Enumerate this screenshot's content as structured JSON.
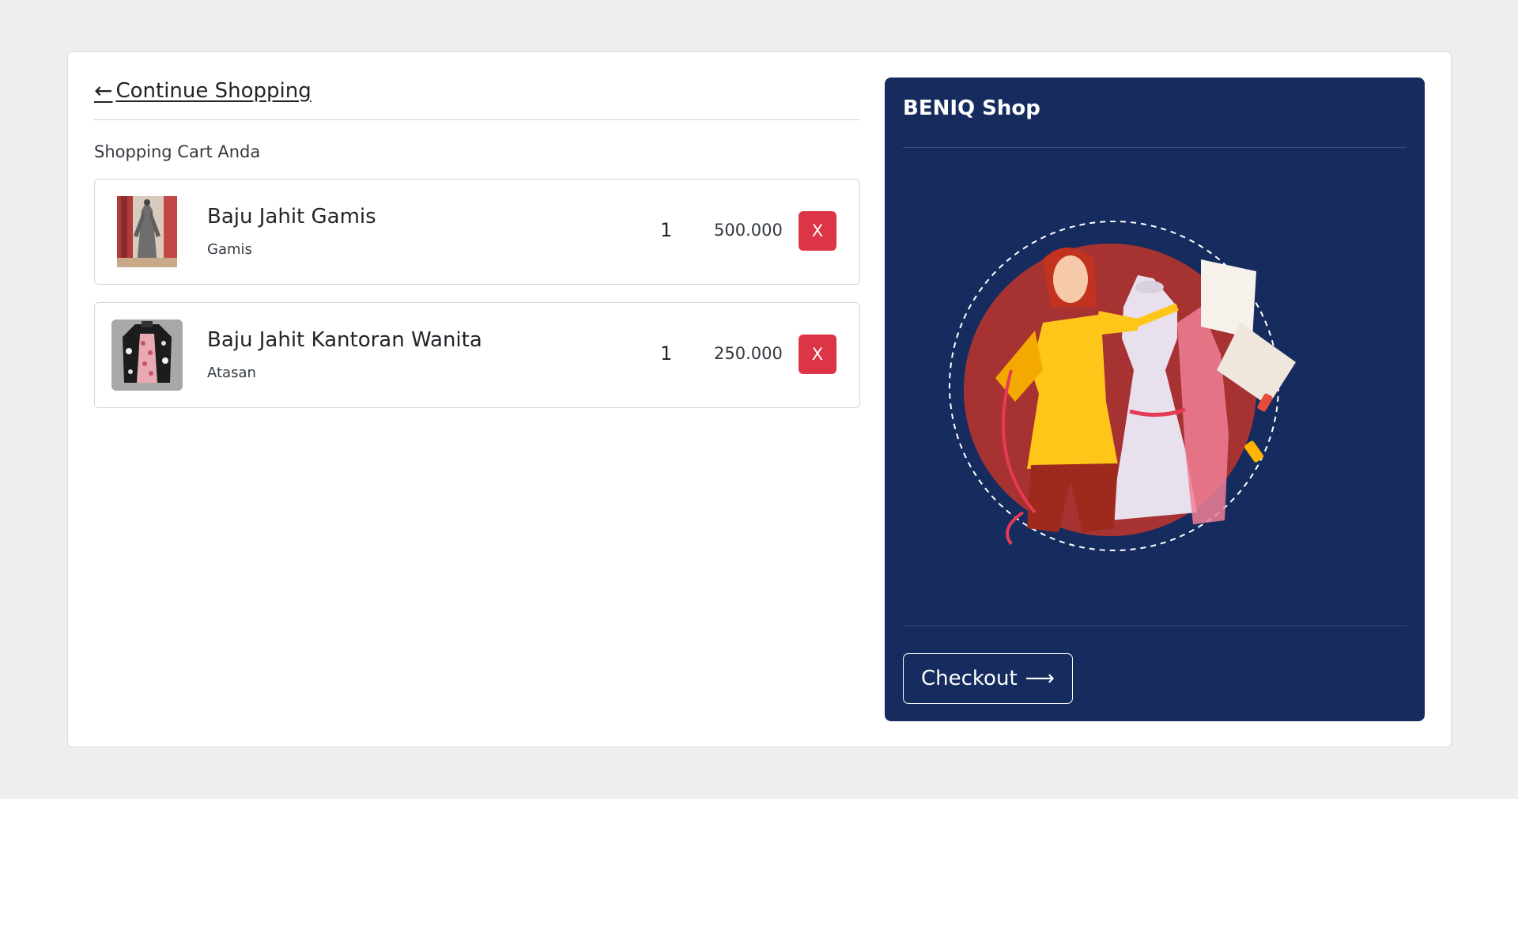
{
  "nav": {
    "back_label": "Continue Shopping",
    "back_icon": "arrow-left-icon"
  },
  "cart": {
    "title": "Shopping Cart Anda",
    "items": [
      {
        "name": "Baju Jahit Gamis",
        "category": "Gamis",
        "qty": "1",
        "price": "500.000",
        "remove_label": "X"
      },
      {
        "name": "Baju Jahit Kantoran Wanita",
        "category": "Atasan",
        "qty": "1",
        "price": "250.000",
        "remove_label": "X"
      }
    ]
  },
  "summary": {
    "shop_name": "BENIQ Shop",
    "checkout_label": "Checkout",
    "checkout_icon": "arrow-right-icon"
  },
  "colors": {
    "panel": "#172c5e",
    "danger": "#dc3545",
    "page_bg": "#eeeeee"
  }
}
